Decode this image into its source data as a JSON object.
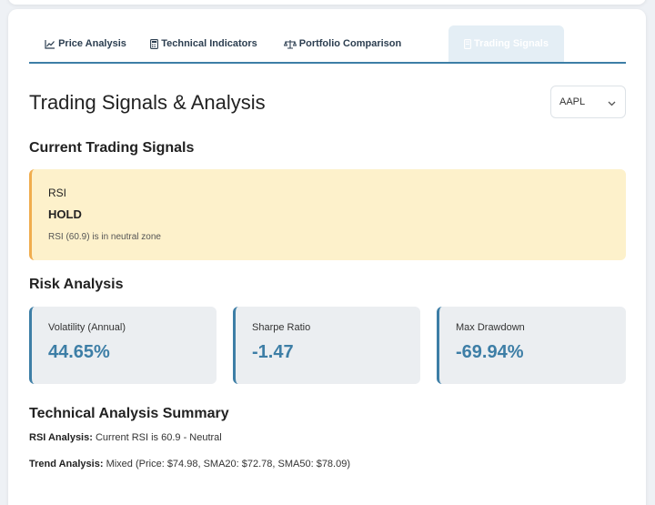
{
  "tabs": [
    {
      "label": "Price Analysis",
      "icon": "line-chart-icon"
    },
    {
      "label": "Technical Indicators",
      "icon": "calculator-icon"
    },
    {
      "label": "Portfolio Comparison",
      "icon": "scale-icon"
    },
    {
      "label": "Trading Signals",
      "icon": "trading-signals-icon",
      "active": true
    }
  ],
  "header": {
    "title": "Trading Signals & Analysis",
    "ticker_select": {
      "value": "AAPL"
    }
  },
  "signals": {
    "section_title": "Current Trading Signals",
    "items": [
      {
        "indicator": "RSI",
        "action": "HOLD",
        "description": "RSI (60.9) is in neutral zone"
      }
    ]
  },
  "risk": {
    "section_title": "Risk Analysis",
    "metrics": [
      {
        "label": "Volatility (Annual)",
        "value": "44.65%"
      },
      {
        "label": "Sharpe Ratio",
        "value": "-1.47"
      },
      {
        "label": "Max Drawdown",
        "value": "-69.94%"
      }
    ]
  },
  "summary": {
    "section_title": "Technical Analysis Summary",
    "rsi_label": "RSI Analysis:",
    "rsi_text": "Current RSI is 60.9 - Neutral",
    "trend_label": "Trend Analysis:",
    "trend_text": "Mixed (Price: $74.98, SMA20: $72.78, SMA50: $78.09)"
  },
  "colors": {
    "accent": "#3d7ea6",
    "hold_bg": "#fdf1cb",
    "hold_border": "#f0ad4e",
    "metric_bg": "#ebeef1"
  }
}
